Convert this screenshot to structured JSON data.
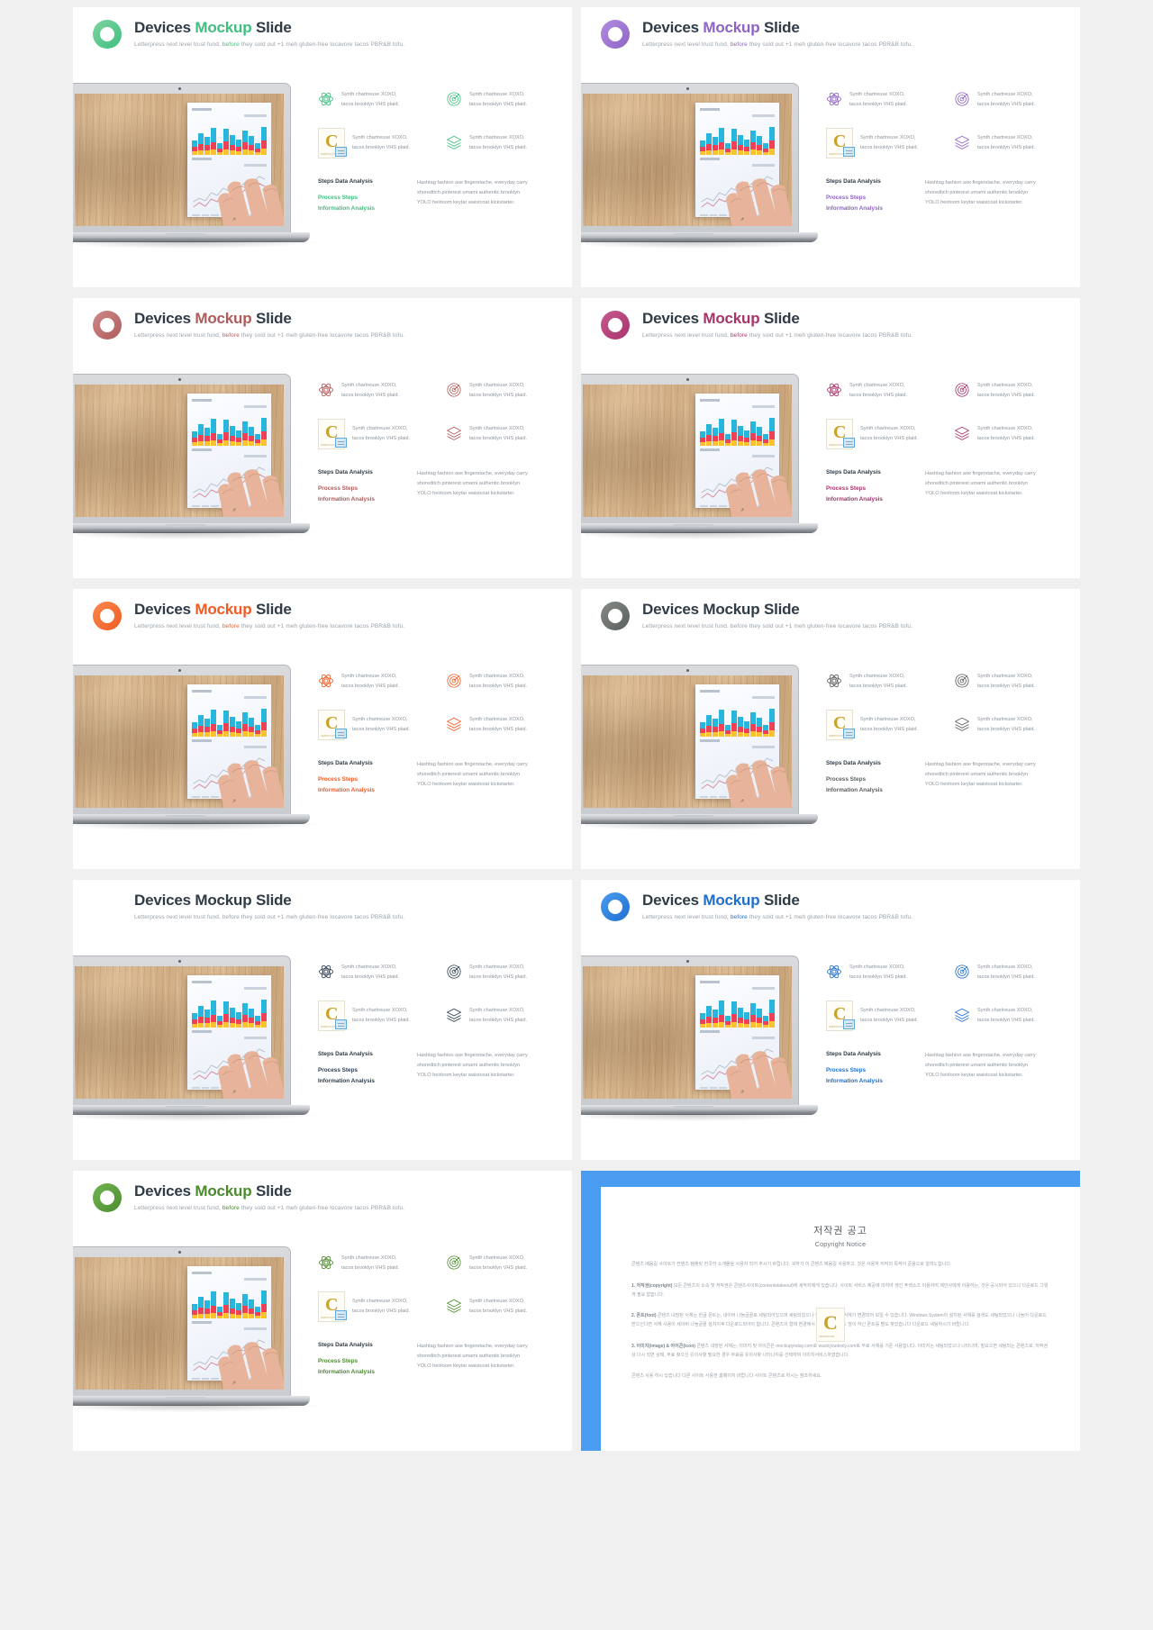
{
  "slides": [
    {
      "accent": "#3fbf7f",
      "accent2": "#7fd4a0",
      "title_1": "Devices ",
      "title_2": "Mockup",
      "title_3": " Slide",
      "subtitle_a": "Letterpress next level trust fund, ",
      "subtitle_b": "before",
      "subtitle_c": " they sold out +1 meh gluten-free locavore tacos PBR&B tofu.",
      "features": [
        {
          "icon": "atom-icon",
          "line1": "Synth chartreuse XOXO,",
          "line2": "tacos brooklyn VHS plaid."
        },
        {
          "icon": "target-icon",
          "line1": "Synth chartreuse XOXO,",
          "line2": "tacos brooklyn VHS plaid."
        },
        {
          "icon": "certificate-badge-icon",
          "line1": "Synth chartreuse XOXO,",
          "line2": "tacos brooklyn VHS plaid."
        },
        {
          "icon": "layers-icon",
          "line1": "Synth chartreuse XOXO,",
          "line2": "tacos brooklyn VHS plaid."
        }
      ],
      "bottom_heading": "Steps Data Analysis",
      "bottom_accent_1": "Process Steps",
      "bottom_accent_2": "Information Analysis",
      "bottom_body_1": "Hashtag fashion axe fingerstache, everyday carry",
      "bottom_body_2": "shoreditch pinterest umami authentic brooklyn",
      "bottom_body_3": "YOLO heirloom keytar waistcoat kickstarter."
    },
    {
      "accent": "#8f63c4",
      "accent2": "#b28de0",
      "title_1": "Devices ",
      "title_2": "Mockup",
      "title_3": " Slide",
      "subtitle_a": "Letterpress next level trust fund, ",
      "subtitle_b": "before",
      "subtitle_c": " they sold out +1 meh gluten-free locavore tacos PBR&B tofu.",
      "features": [
        {
          "icon": "atom-icon",
          "line1": "Synth chartreuse XOXO,",
          "line2": "tacos brooklyn VHS plaid."
        },
        {
          "icon": "target-icon",
          "line1": "Synth chartreuse XOXO,",
          "line2": "tacos brooklyn VHS plaid."
        },
        {
          "icon": "certificate-badge-icon",
          "line1": "Synth chartreuse XOXO,",
          "line2": "tacos brooklyn VHS plaid."
        },
        {
          "icon": "layers-icon",
          "line1": "Synth chartreuse XOXO,",
          "line2": "tacos brooklyn VHS plaid."
        }
      ],
      "bottom_heading": "Steps Data Analysis",
      "bottom_accent_1": "Process Steps",
      "bottom_accent_2": "Information Analysis",
      "bottom_body_1": "Hashtag fashion axe fingerstache, everyday carry",
      "bottom_body_2": "shoreditch pinterest umami authentic brooklyn",
      "bottom_body_3": "YOLO heirloom keytar waistcoat kickstarter."
    },
    {
      "accent": "#b05a5a",
      "accent2": "#cf8a8a",
      "title_1": "Devices ",
      "title_2": "Mockup",
      "title_3": " Slide",
      "subtitle_a": "Letterpress next level trust fund, ",
      "subtitle_b": "before",
      "subtitle_c": " they sold out +1 meh gluten-free locavore tacos PBR&B tofu.",
      "features": [
        {
          "icon": "atom-icon",
          "line1": "Synth chartreuse XOXO,",
          "line2": "tacos brooklyn VHS plaid."
        },
        {
          "icon": "target-icon",
          "line1": "Synth chartreuse XOXO,",
          "line2": "tacos brooklyn VHS plaid."
        },
        {
          "icon": "certificate-badge-icon",
          "line1": "Synth chartreuse XOXO,",
          "line2": "tacos brooklyn VHS plaid."
        },
        {
          "icon": "layers-icon",
          "line1": "Synth chartreuse XOXO,",
          "line2": "tacos brooklyn VHS plaid."
        }
      ],
      "bottom_heading": "Steps Data Analysis",
      "bottom_accent_1": "Process Steps",
      "bottom_accent_2": "Information Analysis",
      "bottom_body_1": "Hashtag fashion axe fingerstache, everyday carry",
      "bottom_body_2": "shoreditch pinterest umami authentic brooklyn",
      "bottom_body_3": "YOLO heirloom keytar waistcoat kickstarter."
    },
    {
      "accent": "#a8336b",
      "accent2": "#c75a91",
      "title_1": "Devices ",
      "title_2": "Mockup",
      "title_3": " Slide",
      "subtitle_a": "Letterpress next level trust fund, ",
      "subtitle_b": "before",
      "subtitle_c": " they sold out +1 meh gluten-free locavore tacos PBR&B tofu.",
      "features": [
        {
          "icon": "atom-icon",
          "line1": "Synth chartreuse XOXO,",
          "line2": "tacos brooklyn VHS plaid."
        },
        {
          "icon": "target-icon",
          "line1": "Synth chartreuse XOXO,",
          "line2": "tacos brooklyn VHS plaid."
        },
        {
          "icon": "certificate-badge-icon",
          "line1": "Synth chartreuse XOXO,",
          "line2": "tacos brooklyn VHS plaid."
        },
        {
          "icon": "layers-icon",
          "line1": "Synth chartreuse XOXO,",
          "line2": "tacos brooklyn VHS plaid."
        }
      ],
      "bottom_heading": "Steps Data Analysis",
      "bottom_accent_1": "Process Steps",
      "bottom_accent_2": "Information Analysis",
      "bottom_body_1": "Hashtag fashion axe fingerstache, everyday carry",
      "bottom_body_2": "shoreditch pinterest umami authentic brooklyn",
      "bottom_body_3": "YOLO heirloom keytar waistcoat kickstarter."
    },
    {
      "accent": "#f15a22",
      "accent2": "#f98a4d",
      "title_1": "Devices ",
      "title_2": "Mockup",
      "title_3": " Slide",
      "subtitle_a": "Letterpress next level trust fund, ",
      "subtitle_b": "before",
      "subtitle_c": " they sold out +1 meh gluten-free locavore tacos PBR&B tofu.",
      "features": [
        {
          "icon": "atom-icon",
          "line1": "Synth chartreuse XOXO,",
          "line2": "tacos brooklyn VHS plaid."
        },
        {
          "icon": "target-icon",
          "line1": "Synth chartreuse XOXO,",
          "line2": "tacos brooklyn VHS plaid."
        },
        {
          "icon": "certificate-badge-icon",
          "line1": "Synth chartreuse XOXO,",
          "line2": "tacos brooklyn VHS plaid."
        },
        {
          "icon": "layers-icon",
          "line1": "Synth chartreuse XOXO,",
          "line2": "tacos brooklyn VHS plaid."
        }
      ],
      "bottom_heading": "Steps Data Analysis",
      "bottom_accent_1": "Process Steps",
      "bottom_accent_2": "Information Analysis",
      "bottom_body_1": "Hashtag fashion axe fingerstache, everyday carry",
      "bottom_body_2": "shoreditch pinterest umami authentic brooklyn",
      "bottom_body_3": "YOLO heirloom keytar waistcoat kickstarter."
    },
    {
      "accent": "#5a5f5c",
      "accent2": "#868b88",
      "title_1": "Devices Mockup Slide",
      "title_2": "",
      "title_3": "",
      "subtitle_a": "Letterpress next level trust fund, before they sold out +1 meh gluten-free locavore tacos PBR&B tofu.",
      "subtitle_b": "",
      "subtitle_c": "",
      "features": [
        {
          "icon": "atom-icon",
          "line1": "Synth chartreuse XOXO,",
          "line2": "tacos brooklyn VHS plaid."
        },
        {
          "icon": "target-icon",
          "line1": "Synth chartreuse XOXO,",
          "line2": "tacos brooklyn VHS plaid."
        },
        {
          "icon": "certificate-badge-icon",
          "line1": "Synth chartreuse XOXO,",
          "line2": "tacos brooklyn VHS plaid."
        },
        {
          "icon": "layers-icon",
          "line1": "Synth chartreuse XOXO,",
          "line2": "tacos brooklyn VHS plaid."
        }
      ],
      "bottom_heading": "Steps Data Analysis",
      "bottom_accent_1": "Process Steps",
      "bottom_accent_2": "Information Analysis",
      "bottom_body_1": "Hashtag fashion axe fingerstache, everyday carry",
      "bottom_body_2": "shoreditch pinterest umami authentic brooklyn",
      "bottom_body_3": "YOLO heirloom keytar waistcoat kickstarter."
    },
    {
      "accent": "#2c3e50",
      "accent2": "#4e6madd",
      "title_1": "Devices Mockup Slide",
      "title_2": "",
      "title_3": "",
      "subtitle_a": "Letterpress next level trust fund, before they sold out +1 meh gluten-free locavore tacos PBR&B tofu.",
      "subtitle_b": "",
      "subtitle_c": "",
      "features": [
        {
          "icon": "atom-icon",
          "line1": "Synth chartreuse XOXO,",
          "line2": "tacos brooklyn VHS plaid."
        },
        {
          "icon": "target-icon",
          "line1": "Synth chartreuse XOXO,",
          "line2": "tacos brooklyn VHS plaid."
        },
        {
          "icon": "certificate-badge-icon",
          "line1": "Synth chartreuse XOXO,",
          "line2": "tacos brooklyn VHS plaid."
        },
        {
          "icon": "layers-icon",
          "line1": "Synth chartreuse XOXO,",
          "line2": "tacos brooklyn VHS plaid."
        }
      ],
      "bottom_heading": "Steps Data Analysis",
      "bottom_accent_1": "Process Steps",
      "bottom_accent_2": "Information Analysis",
      "bottom_body_1": "Hashtag fashion axe fingerstache, everyday carry",
      "bottom_body_2": "shoreditch pinterest umami authentic brooklyn",
      "bottom_body_3": "YOLO heirloom keytar waistcoat kickstarter."
    },
    {
      "accent": "#1f6fd0",
      "accent2": "#4a9cf0",
      "title_1": "Devices ",
      "title_2": "Mockup",
      "title_3": " Slide",
      "subtitle_a": "Letterpress next level trust fund, ",
      "subtitle_b": "before",
      "subtitle_c": " they sold out +1 meh gluten-free locavore tacos PBR&B tofu.",
      "features": [
        {
          "icon": "atom-icon",
          "line1": "Synth chartreuse XOXO,",
          "line2": "tacos brooklyn VHS plaid."
        },
        {
          "icon": "target-icon",
          "line1": "Synth chartreuse XOXO,",
          "line2": "tacos brooklyn VHS plaid."
        },
        {
          "icon": "certificate-badge-icon",
          "line1": "Synth chartreuse XOXO,",
          "line2": "tacos brooklyn VHS plaid."
        },
        {
          "icon": "layers-icon",
          "line1": "Synth chartreuse XOXO,",
          "line2": "tacos brooklyn VHS plaid."
        }
      ],
      "bottom_heading": "Steps Data Analysis",
      "bottom_accent_1": "Process Steps",
      "bottom_accent_2": "Information Analysis",
      "bottom_body_1": "Hashtag fashion axe fingerstache, everyday carry",
      "bottom_body_2": "shoreditch pinterest umami authentic brooklyn",
      "bottom_body_3": "YOLO heirloom keytar waistcoat kickstarter."
    },
    {
      "accent": "#4a8b2c",
      "accent2": "#73b553",
      "title_1": "Devices ",
      "title_2": "Mockup",
      "title_3": " Slide",
      "subtitle_a": "Letterpress next level trust fund, ",
      "subtitle_b": "before",
      "subtitle_c": " they sold out +1 meh gluten-free locavore tacos PBR&B tofu.",
      "features": [
        {
          "icon": "atom-icon",
          "line1": "Synth chartreuse XOXO,",
          "line2": "tacos brooklyn VHS plaid."
        },
        {
          "icon": "target-icon",
          "line1": "Synth chartreuse XOXO,",
          "line2": "tacos brooklyn VHS plaid."
        },
        {
          "icon": "certificate-badge-icon",
          "line1": "Synth chartreuse XOXO,",
          "line2": "tacos brooklyn VHS plaid."
        },
        {
          "icon": "layers-icon",
          "line1": "Synth chartreuse XOXO,",
          "line2": "tacos brooklyn VHS plaid."
        }
      ],
      "bottom_heading": "Steps Data Analysis",
      "bottom_accent_1": "Process Steps",
      "bottom_accent_2": "Information Analysis",
      "bottom_body_1": "Hashtag fashion axe fingerstache, everyday carry",
      "bottom_body_2": "shoreditch pinterest umami authentic brooklyn",
      "bottom_body_3": "YOLO heirloom keytar waistcoat kickstarter."
    }
  ],
  "copyright": {
    "frame_color": "#4a9cf0",
    "heading_ko": "저작권 공고",
    "heading_en": "Copyright Notice",
    "para_1": "콘텐츠 배움길 사이트가 컨텐츠 템플릿 한국어 소개물을 사용자 되어 주시기 바랍니다. 귀하가 이 콘텐츠 배움길 사용하고, 것은 사용자 저작의 목적이 준용으로 알려노합니다.",
    "para_2_label": "1. 저작권(copyright)",
    "para_2": "모든 콘텐츠의 소속 및 저작권은 콘텐츠사이트(contentstakeout)에 세작자에게 있습니다. 사이트 서비스 제공에 의하여 생긴 푸렉쇼즈 이용하여 제안사에게 이용하는, 것은 공시되어 있으나 다운로드 그렇게 필요 없습니다.",
    "para_3_label": "2. 폰트(font)",
    "para_3": "콘텐츠 내장된 서체는 한글 폰트는, 네이버 나눔글꼴로 세팅되어있으며 세팅되었으나 한글 없는 경우 서체가 변경되어 보일 수 있습니다. Windows System이 설치된 서체를 검색도 세팅되었으나 나눔어 다운로드 받으신다면 서체 사용이 세이버 나눔글꼴 설치이후 다운로드되어야 합니다. 콘텐츠의 형태 변경에서 있으므로 필요도 많이 하신 폰트를 별도 찾았습니다 다운로드 세팅하시기 바랍니다.",
    "para_4_label": "3. 이미지(image) & 아이콘(icon)",
    "para_4": "콘텐츠 내장된 서체는, 이미지 및 아이콘은 mockupyoday.com로 wasbyoudesly.com로 무료 서체를 기준 사용합니다. 이미지는 세팅되었으나 나타나며, 필요으면 세팅되는 콘텐츠로, 저작권 상 다시 되면 상태, 무료 찾으신 유의사항 필요한 경우 무료를 유의사항 나타나지를 선택하여 이미지서비스하였습니다.",
    "para_5": "콘텐츠 사용 하시 있습니다 다른 사이트 사용한 홈페이지 바랍니다 사이트 콘텐츠로 하시는 참조하세요."
  }
}
